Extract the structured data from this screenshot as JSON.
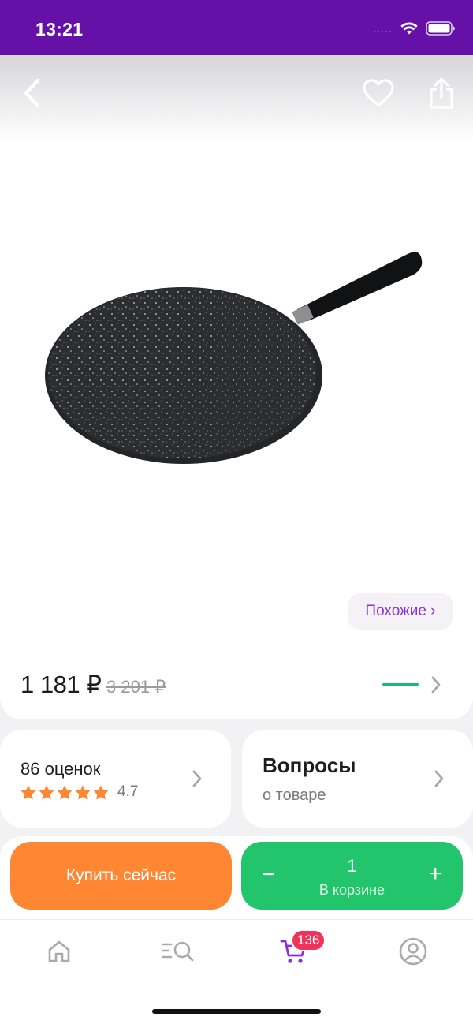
{
  "status_bar": {
    "time": "13:21",
    "signal": "....."
  },
  "product": {
    "similar_label": "Похожие ›"
  },
  "price": {
    "current": "1 181 ₽",
    "old": "3 201 ₽"
  },
  "rating": {
    "count_label": "86 оценок",
    "value": "4.7",
    "stars": 5
  },
  "questions": {
    "title": "Вопросы",
    "subtitle": "о товаре"
  },
  "actions": {
    "buy_now": "Купить сейчас",
    "quantity": "1",
    "in_cart": "В корзине",
    "minus": "−",
    "plus": "+"
  },
  "tabbar": {
    "cart_badge": "136"
  },
  "colors": {
    "brand": "#6511a8",
    "accent_purple": "#8d2fd9",
    "buy": "#ff8632",
    "cart": "#22c56b",
    "badge": "#f0335a",
    "star": "#ff8632"
  }
}
